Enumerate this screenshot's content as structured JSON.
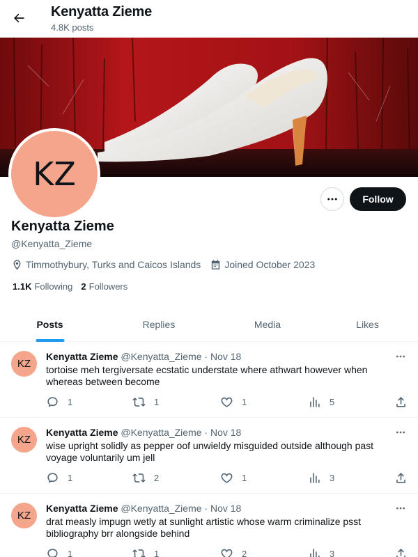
{
  "header": {
    "title": "Kenyatta Zieme",
    "post_count": "4.8K posts"
  },
  "colors": {
    "avatar_bg": "#f5a58b",
    "follow_bg": "#0f1419",
    "accent": "#1d9bf0",
    "banner_red": "#b01518"
  },
  "profile": {
    "avatar_initials": "KZ",
    "name": "Kenyatta Zieme",
    "handle": "@Kenyatta_Zieme",
    "location": "Timmothybury, Turks and Caicos Islands",
    "joined": "Joined October 2023",
    "following_count": "1.1K",
    "following_label": "Following",
    "followers_count": "2",
    "followers_label": "Followers",
    "follow_button": "Follow",
    "more_icon": "more-dots-icon"
  },
  "tabs": [
    {
      "label": "Posts",
      "active": true
    },
    {
      "label": "Replies",
      "active": false
    },
    {
      "label": "Media",
      "active": false
    },
    {
      "label": "Likes",
      "active": false
    }
  ],
  "posts": [
    {
      "initials": "KZ",
      "name": "Kenyatta Zieme",
      "handle": "@Kenyatta_Zieme",
      "dot": "·",
      "date": "Nov 18",
      "text": "tortoise meh tergiversate ecstatic understate where athwart however when whereas between become",
      "replies": "1",
      "reposts": "1",
      "likes": "1",
      "views": "5"
    },
    {
      "initials": "KZ",
      "name": "Kenyatta Zieme",
      "handle": "@Kenyatta_Zieme",
      "dot": "·",
      "date": "Nov 18",
      "text": "wise upright solidly as pepper oof unwieldy misguided outside although past voyage voluntarily um jell",
      "replies": "1",
      "reposts": "2",
      "likes": "1",
      "views": "3"
    },
    {
      "initials": "KZ",
      "name": "Kenyatta Zieme",
      "handle": "@Kenyatta_Zieme",
      "dot": "·",
      "date": "Nov 18",
      "text": "drat measly impugn wetly at sunlight artistic whose warm criminalize psst bibliography brr alongside behind",
      "replies": "1",
      "reposts": "1",
      "likes": "2",
      "views": "3"
    }
  ]
}
